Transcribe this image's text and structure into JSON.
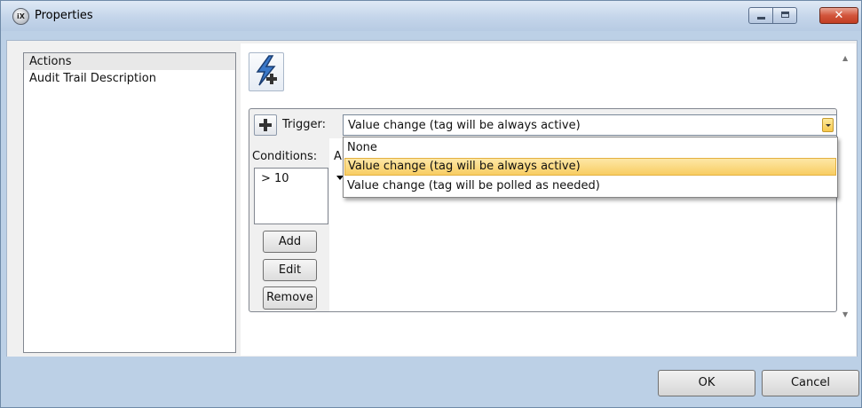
{
  "window": {
    "title": "Properties",
    "icon": "iX-app-icon",
    "icon_text": "iX"
  },
  "titlebar_buttons": {
    "minimize": "minimize-icon",
    "maximize": "maximize-icon",
    "close": "close-icon",
    "close_glyph": "✕"
  },
  "sidebar": {
    "items": [
      {
        "label": "Actions",
        "selected": true
      },
      {
        "label": "Audit Trail Description",
        "selected": false
      }
    ]
  },
  "toolbar": {
    "add_action_icon": "add-action-lightning-icon"
  },
  "action": {
    "add_icon": "plus-icon",
    "trigger_label": "Trigger:",
    "trigger_value": "Value change (tag will be always active)",
    "conditions_label": "Conditions:",
    "actions_label_partial": "A",
    "conditions": [
      "> 10"
    ],
    "buttons": {
      "add": "Add",
      "edit": "Edit",
      "remove": "Remove"
    }
  },
  "dropdown": {
    "options": [
      {
        "label": "None",
        "highlighted": false
      },
      {
        "label": "Value change (tag will be always active)",
        "highlighted": true
      },
      {
        "label": "Value change (tag will be polled as needed)",
        "highlighted": false
      }
    ]
  },
  "footer": {
    "ok": "OK",
    "cancel": "Cancel"
  },
  "colors": {
    "titlebar": "#c4d5ea",
    "highlight": "#f8cd62",
    "close_button": "#d2553c"
  }
}
